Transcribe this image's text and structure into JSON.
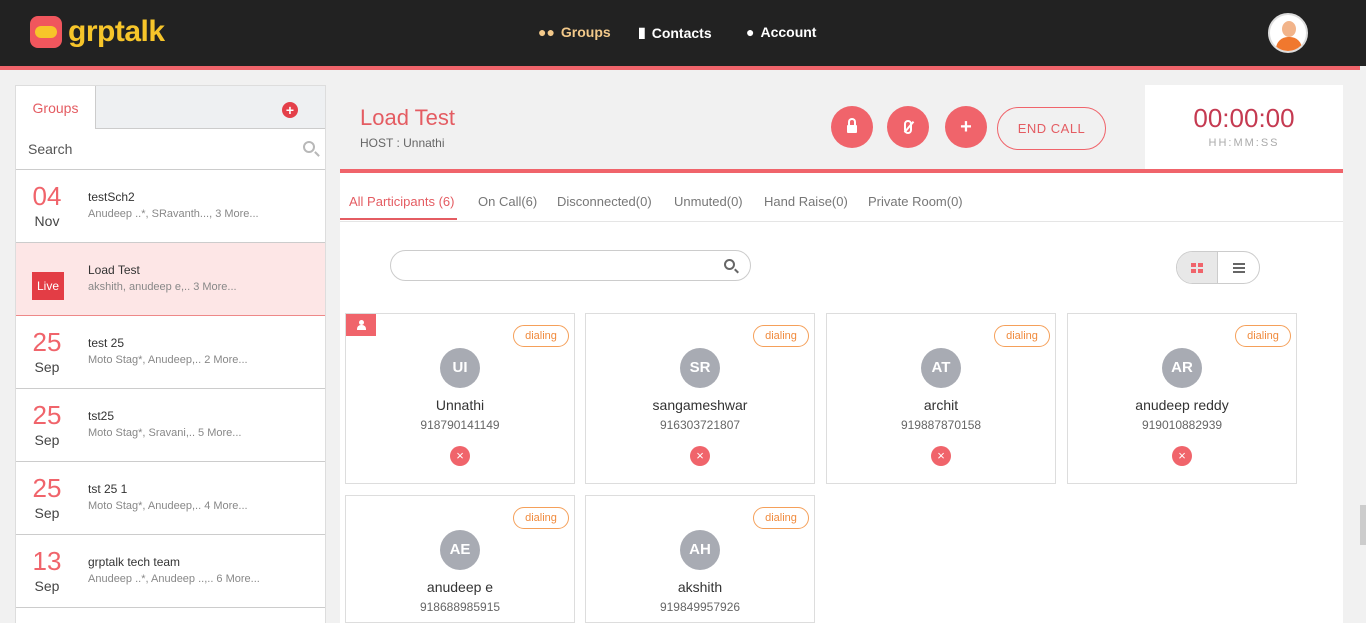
{
  "brand": {
    "name": "grptalk"
  },
  "nav": {
    "groups": "Groups",
    "contacts": "Contacts",
    "account": "Account"
  },
  "sidebar": {
    "tab_label": "Groups",
    "search_placeholder": "Search",
    "groups": [
      {
        "day": "04",
        "month": "Nov",
        "name": "testSch2",
        "members": "Anudeep ..*, SRavanth..., 3 More..."
      },
      {
        "live_label": "Live",
        "name": "Load Test",
        "members": "akshith, anudeep e,.. 3 More..."
      },
      {
        "day": "25",
        "month": "Sep",
        "name": "test 25",
        "members": "Moto Stag*, Anudeep,.. 2 More..."
      },
      {
        "day": "25",
        "month": "Sep",
        "name": "tst25",
        "members": "Moto Stag*, Sravani,.. 5 More..."
      },
      {
        "day": "25",
        "month": "Sep",
        "name": "tst 25 1",
        "members": "Moto Stag*, Anudeep,.. 4 More..."
      },
      {
        "day": "13",
        "month": "Sep",
        "name": "grptalk tech team",
        "members": "Anudeep ..*, Anudeep ..,.. 6 More..."
      }
    ]
  },
  "call": {
    "title": "Load Test",
    "host": "HOST : Unnathi",
    "end_call_label": "END CALL",
    "timer": "00:00:00",
    "timer_label": "HH:MM:SS"
  },
  "tabs": [
    "All Participants (6)",
    "On Call(6)",
    "Disconnected(0)",
    "Unmuted(0)",
    "Hand Raise(0)",
    "Private Room(0)"
  ],
  "participants": [
    {
      "initials": "UI",
      "name": "Unnathi",
      "phone": "918790141149",
      "status": "dialing",
      "host": true
    },
    {
      "initials": "SR",
      "name": "sangameshwar",
      "phone": "916303721807",
      "status": "dialing"
    },
    {
      "initials": "AT",
      "name": "archit",
      "phone": "919887870158",
      "status": "dialing"
    },
    {
      "initials": "AR",
      "name": "anudeep reddy",
      "phone": "919010882939",
      "status": "dialing"
    },
    {
      "initials": "AE",
      "name": "anudeep e",
      "phone": "918688985915",
      "status": "dialing"
    },
    {
      "initials": "AH",
      "name": "akshith",
      "phone": "919849957926",
      "status": "dialing"
    }
  ],
  "icons": {
    "remove": "×",
    "add": "+"
  },
  "colors": {
    "accent": "#f0646b",
    "brand_yellow": "#f7c52a",
    "status": "#f08a3c"
  }
}
